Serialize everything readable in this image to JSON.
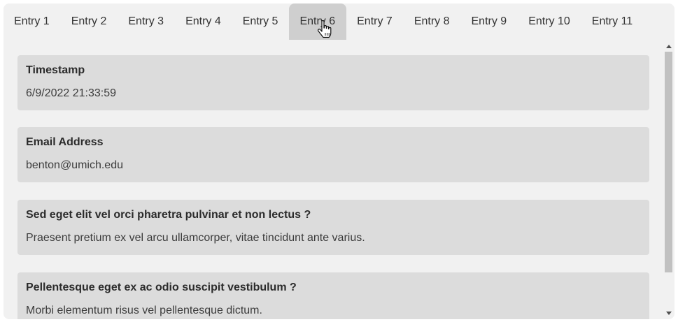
{
  "tabs": [
    {
      "label": "Entry 1",
      "active": false
    },
    {
      "label": "Entry 2",
      "active": false
    },
    {
      "label": "Entry 3",
      "active": false
    },
    {
      "label": "Entry 4",
      "active": false
    },
    {
      "label": "Entry 5",
      "active": false
    },
    {
      "label": "Entry 6",
      "active": true
    },
    {
      "label": "Entry 7",
      "active": false
    },
    {
      "label": "Entry 8",
      "active": false
    },
    {
      "label": "Entry 9",
      "active": false
    },
    {
      "label": "Entry 10",
      "active": false
    },
    {
      "label": "Entry 11",
      "active": false
    }
  ],
  "fields": [
    {
      "label": "Timestamp",
      "value": "6/9/2022 21:33:59"
    },
    {
      "label": "Email Address",
      "value": "benton@umich.edu"
    },
    {
      "label": "Sed eget elit vel orci pharetra pulvinar et non lectus ?",
      "value": "Praesent pretium ex vel arcu ullamcorper, vitae tincidunt ante varius."
    },
    {
      "label": "Pellentesque eget ex ac odio suscipit vestibulum ?",
      "value": "Morbi elementum risus vel pellentesque dictum."
    }
  ],
  "colors": {
    "background": "#f1f1f1",
    "active_tab": "#cfcfcf",
    "card": "#dcdcdc",
    "scroll_thumb": "#c1c1c1"
  },
  "icons": {
    "scroll_up": "triangle-up-icon",
    "scroll_down": "triangle-down-icon",
    "cursor": "hand-pointer-icon"
  }
}
